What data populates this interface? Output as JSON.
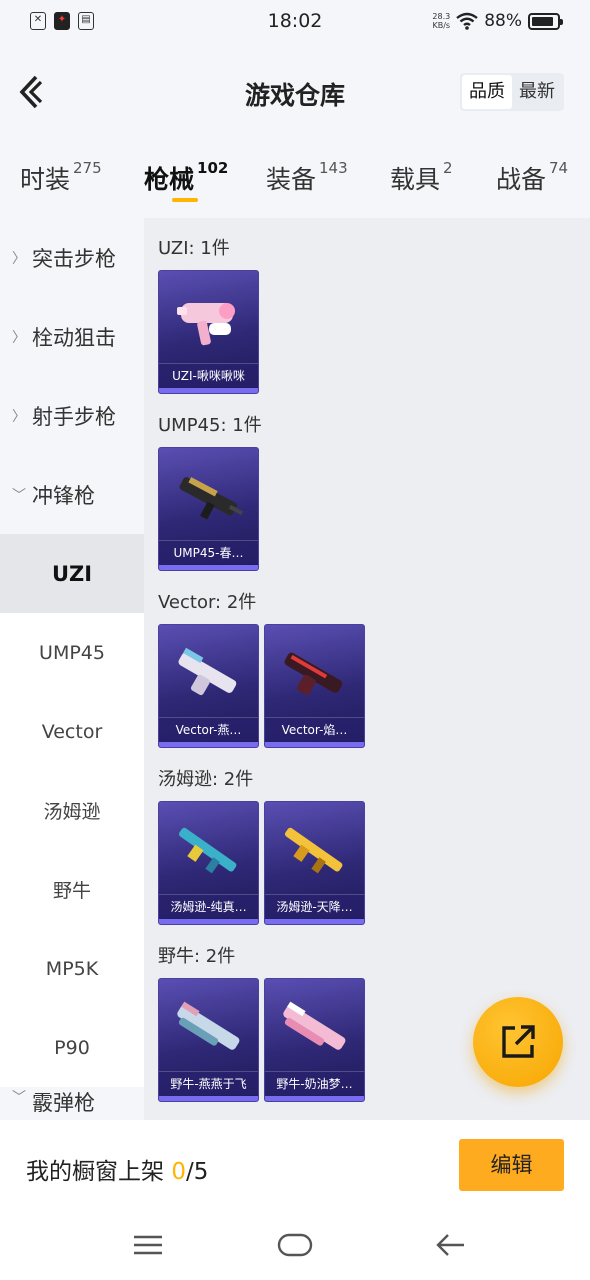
{
  "status_bar": {
    "time": "18:02",
    "net_speed_value": "28.3",
    "net_speed_unit": "KB/s",
    "battery": "88%",
    "battery_level": 0.88
  },
  "header": {
    "title": "游戏仓库",
    "sort_options": [
      "品质",
      "最新"
    ],
    "sort_active": "品质"
  },
  "tabs": [
    {
      "label": "时装",
      "count": "275"
    },
    {
      "label": "枪械",
      "count": "102"
    },
    {
      "label": "装备",
      "count": "143"
    },
    {
      "label": "载具",
      "count": "2"
    },
    {
      "label": "战备",
      "count": "74"
    }
  ],
  "sidebar": {
    "categories": [
      {
        "label": "突击步枪",
        "expanded": false
      },
      {
        "label": "栓动狙击",
        "expanded": false
      },
      {
        "label": "射手步枪",
        "expanded": false
      },
      {
        "label": "冲锋枪",
        "expanded": true
      }
    ],
    "subcategories": [
      "UZI",
      "UMP45",
      "Vector",
      "汤姆逊",
      "野牛",
      "MP5K",
      "P90"
    ],
    "next_category": "霰弹枪",
    "active_sub": "UZI"
  },
  "groups": [
    {
      "title": "UZI: 1件",
      "items": [
        "UZI-啾咪啾咪"
      ]
    },
    {
      "title": "UMP45: 1件",
      "items": [
        "UMP45-春…"
      ]
    },
    {
      "title": "Vector: 2件",
      "items": [
        "Vector-燕…",
        "Vector-焰…"
      ]
    },
    {
      "title": "汤姆逊: 2件",
      "items": [
        "汤姆逊-纯真…",
        "汤姆逊-天降…"
      ]
    },
    {
      "title": "野牛: 2件",
      "items": [
        "野牛-燕燕于飞",
        "野牛-奶油梦…"
      ]
    }
  ],
  "bottom": {
    "showcase_label": "我的橱窗上架",
    "showcase_count": "0",
    "showcase_total": "/5",
    "edit_label": "编辑"
  },
  "colors": {
    "accent": "#ffb400",
    "card_bg": "#2f2876",
    "card_bar": "#7a6cf0",
    "edit_button": "#ffab1f"
  },
  "icons": {
    "back": "back-chevron-icon",
    "fab": "share-export-icon",
    "nav": [
      "menu-icon",
      "home-icon",
      "back-icon"
    ]
  }
}
